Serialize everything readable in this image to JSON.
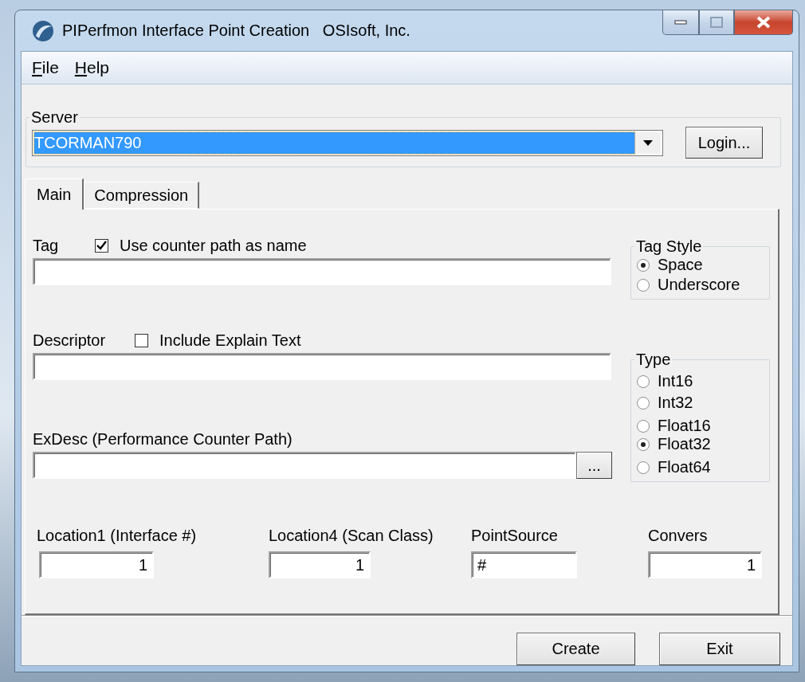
{
  "window": {
    "title": "PIPerfmon Interface Point Creation   OSIsoft, Inc."
  },
  "menu": [
    "File",
    "Help"
  ],
  "server": {
    "label": "Server",
    "value": "TCORMAN790",
    "login_button": "Login..."
  },
  "tabs": [
    {
      "label": "Main",
      "selected": true
    },
    {
      "label": "Compression",
      "selected": false
    }
  ],
  "tag": {
    "label": "Tag",
    "checkbox": {
      "label": "Use counter path as name",
      "checked": true
    }
  },
  "descriptor": {
    "label": "Descriptor",
    "checkbox": {
      "label": "Include Explain Text",
      "checked": false
    }
  },
  "exdesc": {
    "label": "ExDesc (Performance Counter Path)",
    "browse_button": "..."
  },
  "tag_style": {
    "label": "Tag Style",
    "options": [
      {
        "label": "Space",
        "selected": true
      },
      {
        "label": "Underscore",
        "selected": false
      }
    ]
  },
  "type": {
    "label": "Type",
    "options": [
      {
        "label": "Int16",
        "selected": false
      },
      {
        "label": "Int32",
        "selected": false
      },
      {
        "label": "Float16",
        "selected": false
      },
      {
        "label": "Float32",
        "selected": true
      },
      {
        "label": "Float64",
        "selected": false
      }
    ]
  },
  "fields": [
    {
      "label": "Location1 (Interface #)",
      "value": "1",
      "kind": "number"
    },
    {
      "label": "Location4 (Scan Class)",
      "value": "1",
      "kind": "number"
    },
    {
      "label": "PointSource",
      "value": "#",
      "kind": "text"
    },
    {
      "label": "Convers",
      "value": "1",
      "kind": "number"
    }
  ],
  "buttons": [
    "Create",
    "Exit"
  ]
}
